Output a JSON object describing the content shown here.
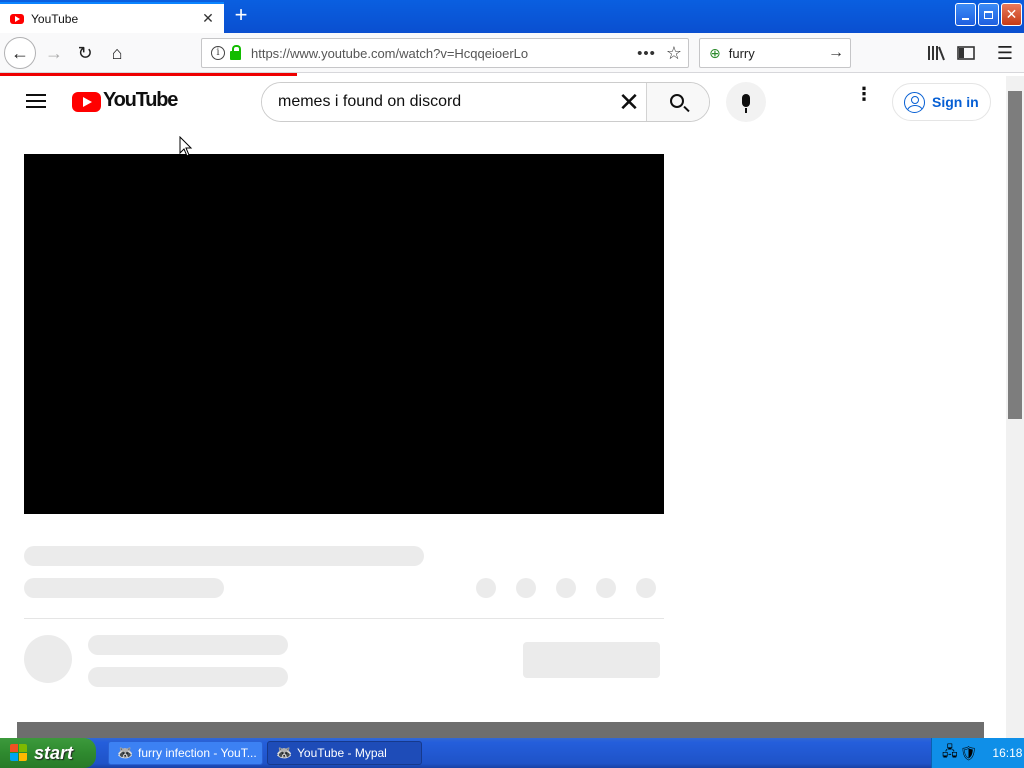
{
  "browser": {
    "tab": {
      "title": "YouTube",
      "close": "✕",
      "favicon": "youtube-favicon"
    },
    "new_tab": "+",
    "window_controls": {
      "minimize": "minimize-icon",
      "maximize": "restore-icon",
      "close": "close-icon"
    },
    "toolbar": {
      "back": "←",
      "forward": "→",
      "reload": "↻",
      "home": "⌂",
      "url": "https://www.youtube.com/watch?v=HcqqeioerLo",
      "page_actions": "•••",
      "bookmark": "☆",
      "search_value": "furry",
      "search_go": "→",
      "library": "library-icon",
      "sidebar": "sidebar-icon",
      "menu": "☰"
    },
    "load_progress": 0.29
  },
  "youtube": {
    "logo_text": "YouTube",
    "search_value": "memes i found on discord",
    "clear": "✕",
    "more": "⋮",
    "signin_label": "Sign in"
  },
  "taskbar": {
    "start_label": "start",
    "tasks": [
      {
        "label": "furry infection - YouT...",
        "icon": "browser-icon",
        "active": false
      },
      {
        "label": "YouTube - Mypal",
        "icon": "browser-icon",
        "active": true
      }
    ],
    "clock": "16:18"
  },
  "colors": {
    "youtube_red": "#ff0000",
    "link_blue": "#065fd4",
    "xp_taskbar": "#245edb",
    "xp_start_green": "#2f8a2f",
    "skeleton": "#ebebeb"
  }
}
